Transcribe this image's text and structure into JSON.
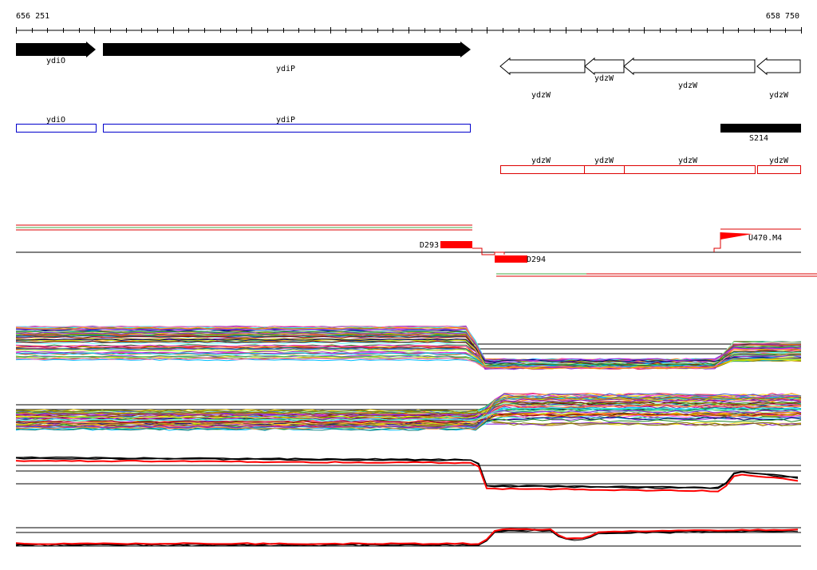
{
  "coords": {
    "start": "656 251",
    "end": "658 750"
  },
  "genes": [
    {
      "name": "ydiO",
      "strand": "+",
      "from": 656251,
      "to": 656351
    },
    {
      "name": "ydiP",
      "strand": "+",
      "from": 656360,
      "to": 656830
    },
    {
      "name": "ydzW",
      "strand": "-",
      "from": 656857,
      "to": 656965
    },
    {
      "name": "ydzW",
      "strand": "-",
      "from": 656965,
      "to": 657015
    },
    {
      "name": "ydzW",
      "strand": "-",
      "from": 657015,
      "to": 657183
    },
    {
      "name": "ydzW",
      "strand": "-",
      "from": 657186,
      "to": 657242
    }
  ],
  "blue_features": [
    {
      "name": "ydiO",
      "from": 656251,
      "to": 656351
    },
    {
      "name": "ydiP",
      "from": 656360,
      "to": 656830
    }
  ],
  "black_feature": {
    "name": "S214",
    "from": 657140,
    "to": 657242
  },
  "red_features": [
    {
      "name": "ydzW",
      "from": 656857,
      "to": 656965
    },
    {
      "name": "ydzW",
      "from": 656965,
      "to": 657015
    },
    {
      "name": "ydzW",
      "from": 657015,
      "to": 657183
    },
    {
      "name": "ydzW",
      "from": 657186,
      "to": 657242
    }
  ],
  "segments": [
    {
      "name": "D293",
      "from": 656803,
      "to": 656841
    },
    {
      "name": "D294",
      "from": 656858,
      "to": 656899
    },
    {
      "name": "U470.M4",
      "from": 657140,
      "to": 657180
    }
  ],
  "colors": {
    "gene": "#000000",
    "feature_blue": "#0000cc",
    "feature_red": "#dd0000",
    "segment_red": "#ff0000",
    "track_green": "#44aa44"
  }
}
